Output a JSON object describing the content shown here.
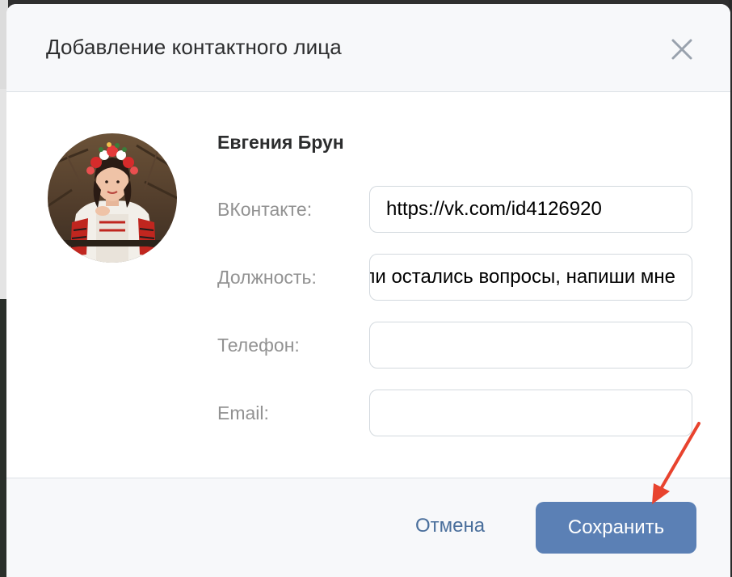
{
  "dialog": {
    "title": "Добавление контактного лица",
    "close_icon": "close-icon"
  },
  "contact": {
    "name": "Евгения Брун",
    "avatar_icon": "avatar-photo"
  },
  "fields": {
    "vk": {
      "label": "ВКонтакте:",
      "value": "https://vk.com/id4126920"
    },
    "position": {
      "label": "Должность:",
      "value": "Если остались вопросы, напиши мне"
    },
    "phone": {
      "label": "Телефон:",
      "value": ""
    },
    "email": {
      "label": "Email:",
      "value": ""
    }
  },
  "footer": {
    "cancel_label": "Отмена",
    "save_label": "Сохранить"
  },
  "colors": {
    "accent": "#5b80b5",
    "link": "#4a6f9c",
    "annotation_arrow": "#e8432e"
  }
}
